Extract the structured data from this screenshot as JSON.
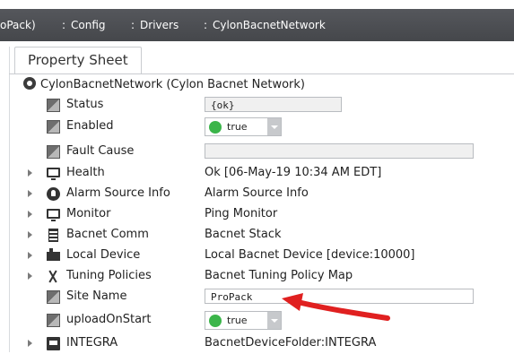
{
  "breadcrumb": {
    "items": [
      "oPack)",
      "Config",
      "Drivers",
      "CylonBacnetNetwork"
    ],
    "separator": ":"
  },
  "tab": {
    "label": "Property Sheet"
  },
  "root": {
    "label": "CylonBacnetNetwork  (Cylon Bacnet Network)",
    "icon": "network-icon"
  },
  "rows": [
    {
      "name": "Status",
      "icon": "slot-icon",
      "value": "{ok}",
      "type": "readonly-field"
    },
    {
      "name": "Enabled",
      "icon": "slot-icon",
      "value": "true",
      "type": "select"
    },
    {
      "name": "Fault Cause",
      "icon": "slot-icon",
      "value": "",
      "type": "readonly-field"
    },
    {
      "name": "Health",
      "icon": "monitor-icon",
      "value": "Ok [06-May-19 10:34 AM EDT]",
      "type": "text"
    },
    {
      "name": "Alarm Source Info",
      "icon": "alarm-icon",
      "value": "Alarm Source Info",
      "type": "text"
    },
    {
      "name": "Monitor",
      "icon": "monitor-icon",
      "value": "Ping Monitor",
      "type": "text"
    },
    {
      "name": "Bacnet Comm",
      "icon": "stack-icon",
      "value": "Bacnet Stack",
      "type": "text"
    },
    {
      "name": "Local Device",
      "icon": "device-icon",
      "value": "Local Bacnet Device [device:10000]",
      "type": "text"
    },
    {
      "name": "Tuning Policies",
      "icon": "tuning-icon",
      "value": "Bacnet Tuning Policy Map",
      "type": "text"
    },
    {
      "name": "Site Name",
      "icon": "slot-icon",
      "value": "ProPack",
      "type": "editable-field"
    },
    {
      "name": "uploadOnStart",
      "icon": "slot-icon",
      "value": "true",
      "type": "select"
    },
    {
      "name": "INTEGRA",
      "icon": "folder-icon",
      "value": "BacnetDeviceFolder:INTEGRA",
      "type": "text"
    }
  ],
  "colors": {
    "breadcrumb_bg": "#4d4f53",
    "arrow": "#e02020",
    "enabled_dot": "#3bb54a"
  }
}
